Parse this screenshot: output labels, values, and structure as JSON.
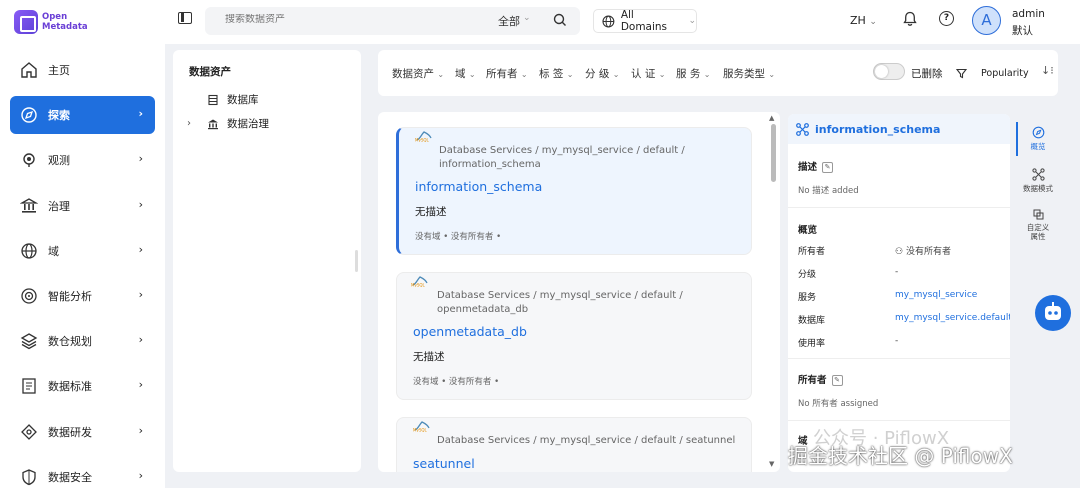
{
  "brand": {
    "line1": "Open",
    "line2": "Metadata"
  },
  "search": {
    "placeholder": "搜索数据资产",
    "scope": "全部"
  },
  "domain_selector": "All Domains",
  "language": "ZH",
  "user": {
    "avatar_letter": "A",
    "name": "admin",
    "role": "默认"
  },
  "sidebar": {
    "items": [
      {
        "label": "主页",
        "icon": "home-icon",
        "active": false,
        "has_children": false
      },
      {
        "label": "探索",
        "icon": "compass-icon",
        "active": true,
        "has_children": true
      },
      {
        "label": "观测",
        "icon": "observe-icon",
        "active": false,
        "has_children": true
      },
      {
        "label": "治理",
        "icon": "bank-icon",
        "active": false,
        "has_children": true
      },
      {
        "label": "域",
        "icon": "globe-icon",
        "active": false,
        "has_children": true
      },
      {
        "label": "智能分析",
        "icon": "analytics-icon",
        "active": false,
        "has_children": true
      },
      {
        "label": "数仓规划",
        "icon": "layers-icon",
        "active": false,
        "has_children": true
      },
      {
        "label": "数据标准",
        "icon": "standard-icon",
        "active": false,
        "has_children": true
      },
      {
        "label": "数据研发",
        "icon": "dev-icon",
        "active": false,
        "has_children": true
      },
      {
        "label": "数据安全",
        "icon": "shield-icon",
        "active": false,
        "has_children": true
      }
    ]
  },
  "tree": {
    "title": "数据资产",
    "items": [
      {
        "label": "数据库",
        "expandable": false
      },
      {
        "label": "数据治理",
        "expandable": true
      }
    ]
  },
  "filters": {
    "items": [
      "数据资产",
      "域",
      "所有者",
      "标 签",
      "分 级",
      "认 证",
      "服 务",
      "服务类型"
    ],
    "deleted_label": "已删除",
    "sort_label": "Popularity"
  },
  "results": [
    {
      "breadcrumb_1": "Database Services  /  my_mysql_service  /  default  /",
      "breadcrumb_2": "information_schema",
      "name": "information_schema",
      "description": "无描述",
      "meta": "没有域  •  没有所有者  •",
      "selected": true
    },
    {
      "breadcrumb_1": "Database Services  /  my_mysql_service  /  default  /",
      "breadcrumb_2": "openmetadata_db",
      "name": "openmetadata_db",
      "description": "无描述",
      "meta": "没有域  •  没有所有者  •",
      "selected": false
    },
    {
      "breadcrumb_1": "Database Services  /  my_mysql_service  /  default  /  seatunnel",
      "breadcrumb_2": "",
      "name": "seatunnel",
      "description": "",
      "meta": "",
      "selected": false
    }
  ],
  "details": {
    "title": "information_schema",
    "description_label": "描述",
    "description_value": "No 描述 added",
    "overview_label": "概览",
    "rows": [
      {
        "label": "所有者",
        "value": "没有所有者"
      },
      {
        "label": "分级",
        "value": "-"
      },
      {
        "label": "服务",
        "value": "my_mysql_service"
      },
      {
        "label": "数据库",
        "value": "my_mysql_service.default"
      },
      {
        "label": "使用率",
        "value": "-"
      }
    ],
    "owners_label": "所有者",
    "owners_value": "No 所有者 assigned",
    "domain_label": "域"
  },
  "rail": {
    "items": [
      "概览",
      "数据模式",
      "自定义属性"
    ]
  },
  "watermark": {
    "line1": "公众号 · PiflowX",
    "line2": "掘金技术社区 @ PiflowX"
  },
  "colors": {
    "accent": "#1f6fde",
    "brand": "#6a3fd6"
  }
}
